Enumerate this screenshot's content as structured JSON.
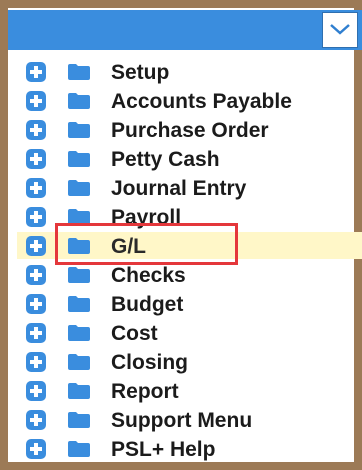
{
  "colors": {
    "frame": "#9c7a56",
    "header": "#3a8dde",
    "icon": "#3a8dde",
    "selected_row_bg": "#fff7c8",
    "selection_outline": "#e4373b"
  },
  "dropdown": {
    "icon": "chevron-down-icon"
  },
  "menu": {
    "items": [
      {
        "label": "Setup"
      },
      {
        "label": "Accounts Payable"
      },
      {
        "label": "Purchase Order"
      },
      {
        "label": "Petty Cash"
      },
      {
        "label": "Journal Entry"
      },
      {
        "label": "Payroll"
      },
      {
        "label": "G/L",
        "selected": true
      },
      {
        "label": "Checks"
      },
      {
        "label": "Budget"
      },
      {
        "label": "Cost"
      },
      {
        "label": "Closing"
      },
      {
        "label": "Report"
      },
      {
        "label": "Support Menu"
      },
      {
        "label": "PSL+ Help"
      }
    ]
  }
}
